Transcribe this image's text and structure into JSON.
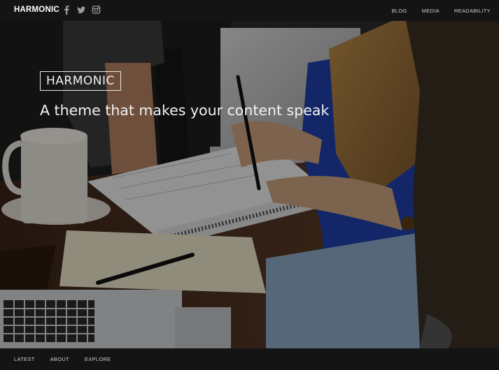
{
  "header": {
    "brand": "HARMONIC",
    "socials": [
      "facebook-icon",
      "twitter-icon",
      "instagram-icon"
    ],
    "nav": [
      "BLOG",
      "MEDIA",
      "READABILITY"
    ]
  },
  "hero": {
    "logo_text": "HARMONIC",
    "tagline": "A theme that makes your content speak"
  },
  "footer": {
    "links": [
      "LATEST",
      "ABOUT",
      "EXPLORE"
    ]
  },
  "colors": {
    "bar": "#141414",
    "text": "#f2f2f2"
  }
}
